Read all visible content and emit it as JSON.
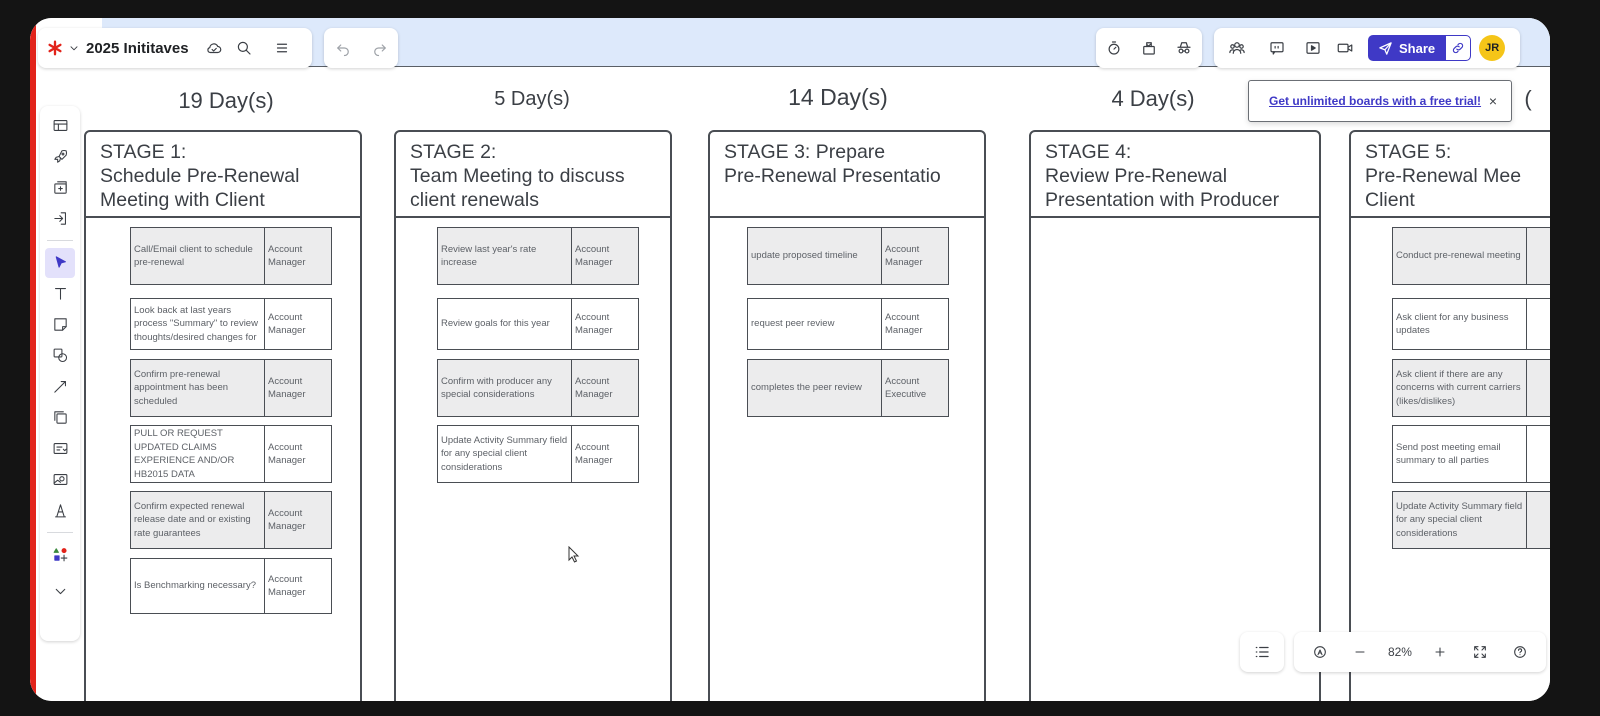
{
  "app": {
    "doc_title": "2025 Inititaves",
    "accent": "#3f39c6",
    "brand_color": "#e2231a"
  },
  "top_left_toolbar": {
    "icons": [
      "lucid-logo-icon",
      "chevron-down-icon",
      "cloud-saved-icon",
      "search-icon",
      "menu-icon"
    ]
  },
  "undo_redo": {
    "icons": [
      "undo-icon",
      "redo-icon"
    ]
  },
  "top_right_toolbar": {
    "icons": [
      "timer-icon",
      "voting-icon",
      "incognito-icon",
      "collaborators-icon",
      "comments-icon",
      "present-icon",
      "video-icon"
    ],
    "share_label": "Share",
    "avatar_initials": "JR"
  },
  "trial_banner": {
    "link_text": "Get unlimited boards with a free trial!",
    "close": "×"
  },
  "left_toolbar": {
    "tools": [
      "templates-icon",
      "rocket-icon",
      "container-add-icon",
      "import-icon",
      "select-icon",
      "text-icon",
      "sticky-note-icon",
      "shapes-icon",
      "line-icon",
      "frame-icon",
      "card-icon",
      "image-icon",
      "draw-icon",
      "more-shapes-icon",
      "expand-icon"
    ],
    "active_tool": "select-icon"
  },
  "board": {
    "stages": [
      {
        "days": "19 Day(s)",
        "title": "STAGE 1:\nSchedule Pre-Renewal\nMeeting with Client",
        "tasks": [
          {
            "text": "Call/Email client to schedule pre-renewal",
            "role": "Account Manager",
            "shaded": true
          },
          {
            "text": "Look back at last years process \"Summary\" to review thoughts/desired changes for",
            "role": "Account Manager",
            "shaded": false
          },
          {
            "text": "Confirm pre-renewal appointment has been scheduled",
            "role": "Account Manager",
            "shaded": true
          },
          {
            "text": "PULL OR REQUEST UPDATED CLAIMS EXPERIENCE AND/OR HB2015 DATA",
            "role": "Account Manager",
            "shaded": false
          },
          {
            "text": "Confirm expected renewal release date and or existing rate guarantees",
            "role": "Account Manager",
            "shaded": true
          },
          {
            "text": "Is Benchmarking necessary?",
            "role": "Account Manager",
            "shaded": false
          }
        ]
      },
      {
        "days": "5 Day(s)",
        "title": "STAGE 2:\nTeam Meeting to discuss\nclient renewals",
        "tasks": [
          {
            "text": "Review last year's rate increase",
            "role": "Account Manager",
            "shaded": true
          },
          {
            "text": "Review goals for this year",
            "role": "Account Manager",
            "shaded": false
          },
          {
            "text": "Confirm with producer any special considerations",
            "role": "Account Manager",
            "shaded": true
          },
          {
            "text": "Update Activity Summary field for any special client considerations",
            "role": "Account Manager",
            "shaded": false
          }
        ]
      },
      {
        "days": "14 Day(s)",
        "title": "STAGE 3: Prepare\nPre-Renewal Presentatio",
        "tasks": [
          {
            "text": "update proposed timeline",
            "role": "Account Manager",
            "shaded": true
          },
          {
            "text": "request peer review",
            "role": "Account Manager",
            "shaded": false
          },
          {
            "text": "completes the peer review",
            "role": "Account Executive",
            "shaded": true
          }
        ]
      },
      {
        "days": "4 Day(s)",
        "title": "STAGE 4:\nReview Pre-Renewal\nPresentation with Producer",
        "tasks": []
      },
      {
        "days": "(",
        "title": "STAGE 5:\nPre-Renewal Mee\nClient",
        "tasks": [
          {
            "text": "Conduct pre-renewal meeting",
            "role": "",
            "shaded": true
          },
          {
            "text": "Ask client for any business updates",
            "role": "",
            "shaded": false
          },
          {
            "text": "Ask client if there are any concerns with current carriers (likes/dislikes)",
            "role": "",
            "shaded": true
          },
          {
            "text": "Send post meeting email summary to all parties",
            "role": "",
            "shaded": false
          },
          {
            "text": "Update Activity Summary field for any special client considerations",
            "role": "",
            "shaded": true
          }
        ]
      }
    ]
  },
  "zoom": {
    "value": "82%"
  }
}
